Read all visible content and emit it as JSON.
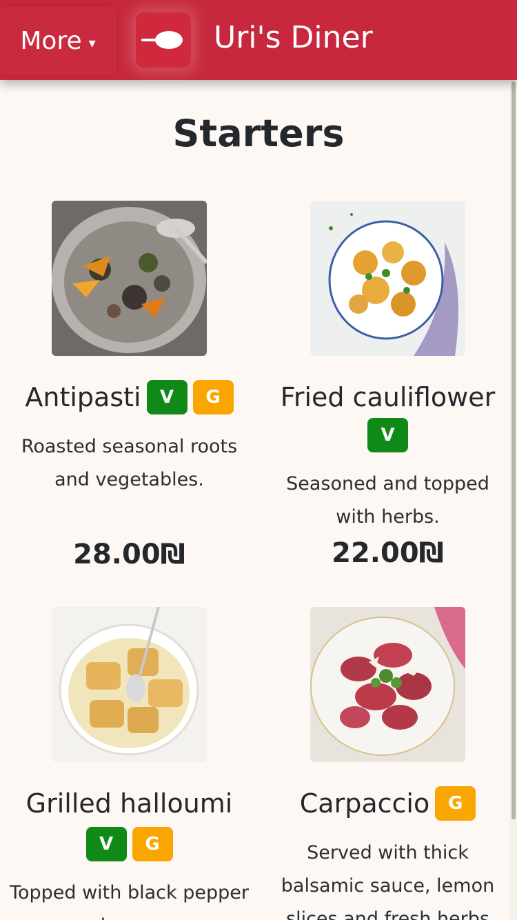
{
  "header": {
    "more_label": "More",
    "more_caret": "▾",
    "brand": "Uri's Diner",
    "logo_icon": "spoon-icon"
  },
  "section": {
    "title": "Starters"
  },
  "colors": {
    "accent": "#c8283d",
    "vegan_badge": "#0f8a17",
    "gluten_badge": "#f9a700"
  },
  "items": [
    {
      "name": "Antipasti",
      "badges": [
        "V",
        "G"
      ],
      "description": "Roasted seasonal roots and vegetables.",
      "price": "28.00₪"
    },
    {
      "name": "Fried cauliflower",
      "badges": [
        "V"
      ],
      "description": "Seasoned and topped with herbs.",
      "price": "22.00₪"
    },
    {
      "name": "Grilled halloumi",
      "badges": [
        "V",
        "G"
      ],
      "description": "Topped with black pepper and oregano",
      "price": ""
    },
    {
      "name": "Carpaccio",
      "badges": [
        "G"
      ],
      "description": "Served with thick balsamic sauce, lemon slices and fresh herbs",
      "price": ""
    }
  ]
}
